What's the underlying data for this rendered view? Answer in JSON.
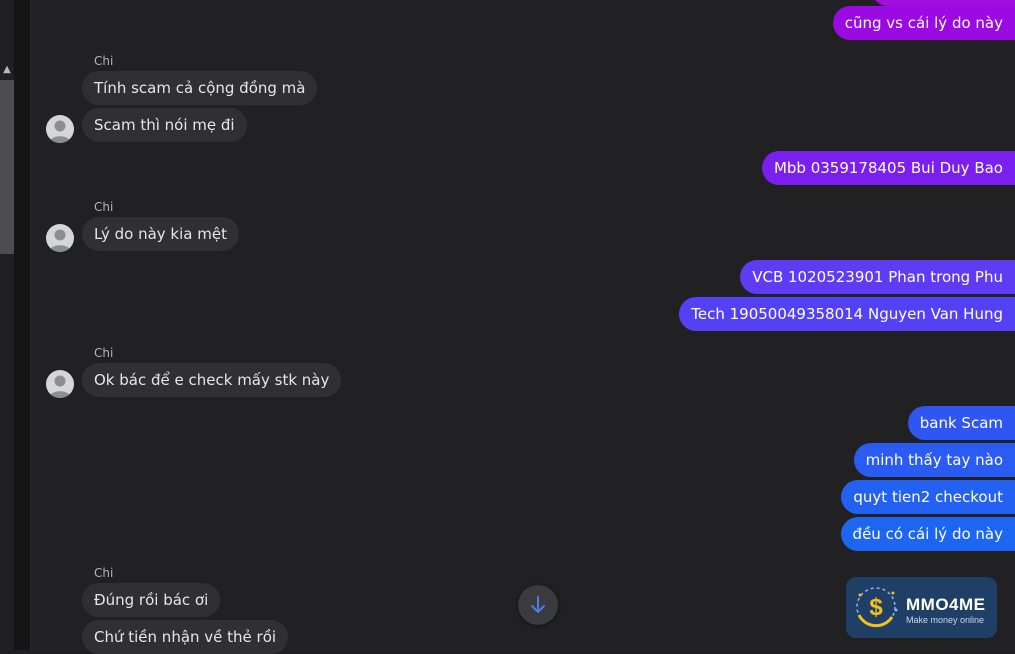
{
  "colors": {
    "incoming_bubble": "#303032",
    "outgoing_gradient": [
      "#9b0ae3",
      "#7a26f2",
      "#5941f5",
      "#2f5bf3",
      "#1f6af2"
    ],
    "background": "#212123",
    "logo_bg": "#1f3f66"
  },
  "messages": {
    "out_1": "cũng vs cái lý do này",
    "name_1": "Chi",
    "in_1a": "Tính scam cả cộng đồng mà",
    "in_1b": "Scam thì nói mẹ đi",
    "out_2": "Mbb 0359178405 Bui Duy Bao",
    "name_2": "Chi",
    "in_2a": "Lý do này kia mệt",
    "out_3a": "VCB 1020523901 Phan trong Phu",
    "out_3b": "Tech 19050049358014 Nguyen Van Hung",
    "name_3": "Chi",
    "in_3a": "Ok bác để e check mấy stk này",
    "out_4a": "bank Scam",
    "out_4b": "minh thấy tay nào",
    "out_4c": "quyt tien2 checkout",
    "out_4d": "đều có cái lý do này",
    "name_4": "Chi",
    "in_4a": "Đúng rồi bác ơi",
    "in_4b": "Chứ tiền nhận về thẻ rồi"
  },
  "icons": {
    "scroll_down": "arrow-down-icon",
    "scroll_up": "caret-up-icon",
    "avatar": "default-user-avatar"
  },
  "watermark": {
    "title": "MMO4ME",
    "subtitle": "Make money online"
  }
}
